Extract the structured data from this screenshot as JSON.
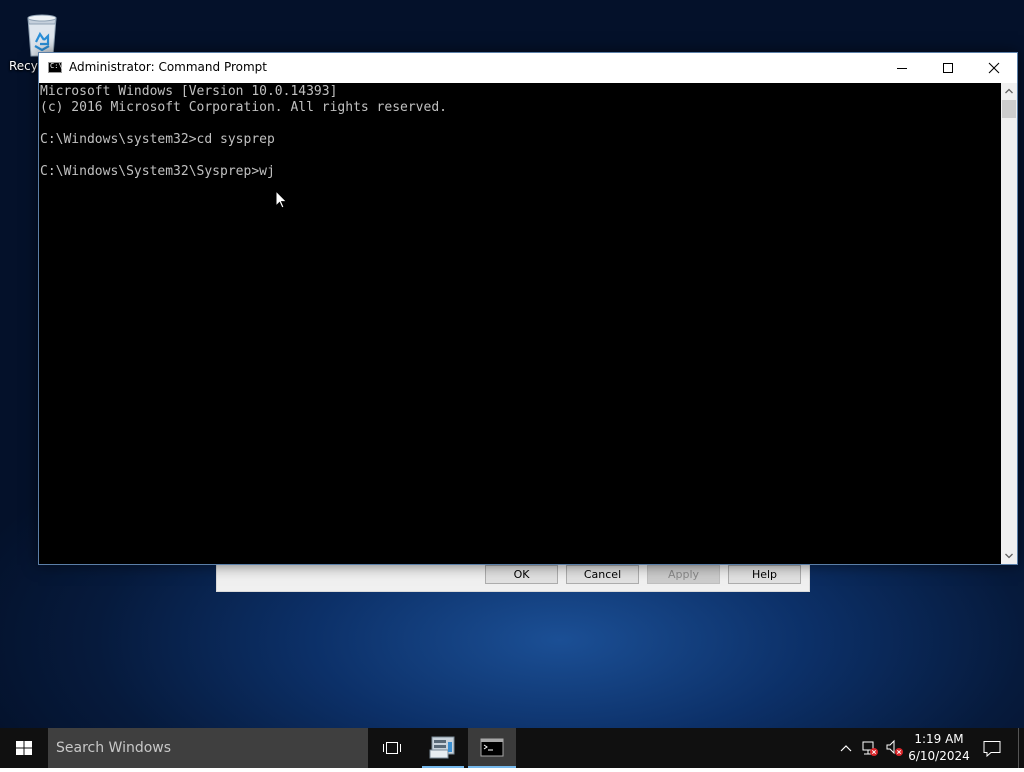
{
  "desktop": {
    "recycle_bin_label": "Recycle Bin"
  },
  "background_dialog": {
    "buttons": {
      "ok": "OK",
      "cancel": "Cancel",
      "apply": "Apply",
      "help": "Help"
    }
  },
  "cmd_window": {
    "title": "Administrator: Command Prompt",
    "console_lines": [
      "Microsoft Windows [Version 10.0.14393]",
      "(c) 2016 Microsoft Corporation. All rights reserved.",
      "",
      "C:\\Windows\\system32>cd sysprep",
      "",
      "C:\\Windows\\System32\\Sysprep>wj"
    ],
    "console_text_color": "#c0c0c0",
    "console_bg_color": "#000000"
  },
  "taskbar": {
    "search_placeholder": "Search Windows",
    "clock_time": "1:19 AM",
    "clock_date": "6/10/2024",
    "accent_color": "#76b9ed",
    "icons": [
      "windows-logo-icon",
      "task-view-icon",
      "server-manager-icon",
      "command-prompt-icon",
      "chevron-up-icon",
      "network-icon",
      "volume-icon",
      "notification-icon"
    ]
  }
}
